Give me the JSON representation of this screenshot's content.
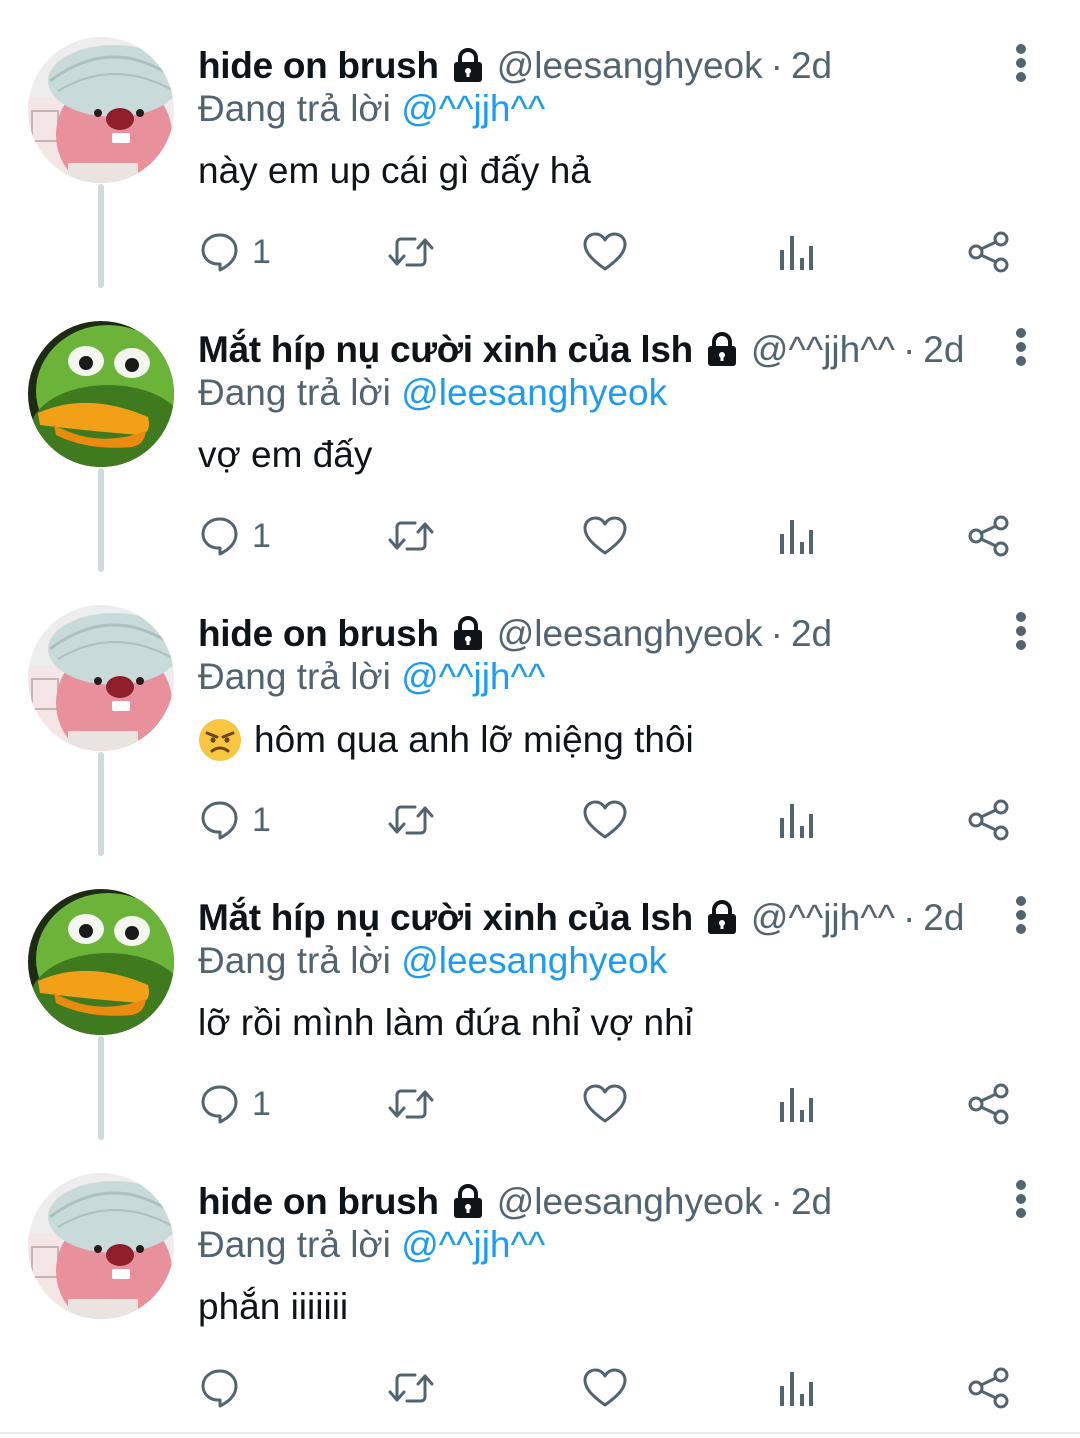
{
  "thread": {
    "tweets": [
      {
        "name": "hide on brush",
        "handle": "@leesanghyeok",
        "dot": "·",
        "time": "2d",
        "replying_prefix": "Đang trả lời",
        "replying_to": "@^^jjh^^",
        "text": "này em up cái gì đấy hả",
        "reply_count": "1",
        "avatar": "pink-plush-avatar",
        "protected_icon": "lock-icon"
      },
      {
        "name": "Mắt híp nụ cười xinh của lsh",
        "handle": "@^^jjh^^",
        "dot": "·",
        "time": "2d",
        "replying_prefix": "Đang trả lời",
        "replying_to": "@leesanghyeok",
        "text": "vợ em đấy",
        "reply_count": "1",
        "avatar": "green-frog-avatar",
        "protected_icon": "lock-icon"
      },
      {
        "name": "hide on brush",
        "handle": "@leesanghyeok",
        "dot": "·",
        "time": "2d",
        "replying_prefix": "Đang trả lời",
        "replying_to": "@^^jjh^^",
        "text": "hôm qua anh lỡ miệng thôi",
        "emoji": "angry-face-emoji",
        "reply_count": "1",
        "avatar": "pink-plush-avatar",
        "protected_icon": "lock-icon"
      },
      {
        "name": "Mắt híp nụ cười xinh của lsh",
        "handle": "@^^jjh^^",
        "dot": "·",
        "time": "2d",
        "replying_prefix": "Đang trả lời",
        "replying_to": "@leesanghyeok",
        "text": "lỡ rồi mình làm đứa nhỉ vợ nhỉ",
        "reply_count": "1",
        "avatar": "green-frog-avatar",
        "protected_icon": "lock-icon"
      },
      {
        "name": "hide on brush",
        "handle": "@leesanghyeok",
        "dot": "·",
        "time": "2d",
        "replying_prefix": "Đang trả lời",
        "replying_to": "@^^jjh^^",
        "text": "phắn iiiiiii",
        "reply_count": "",
        "avatar": "pink-plush-avatar",
        "protected_icon": "lock-icon"
      }
    ],
    "action_icons": [
      "reply-icon",
      "retweet-icon",
      "like-icon",
      "views-icon",
      "share-icon"
    ],
    "colors": {
      "text": "#0f1419",
      "secondary": "#536471",
      "link": "#1d9bf0",
      "thread_line": "#cfd9de"
    }
  }
}
